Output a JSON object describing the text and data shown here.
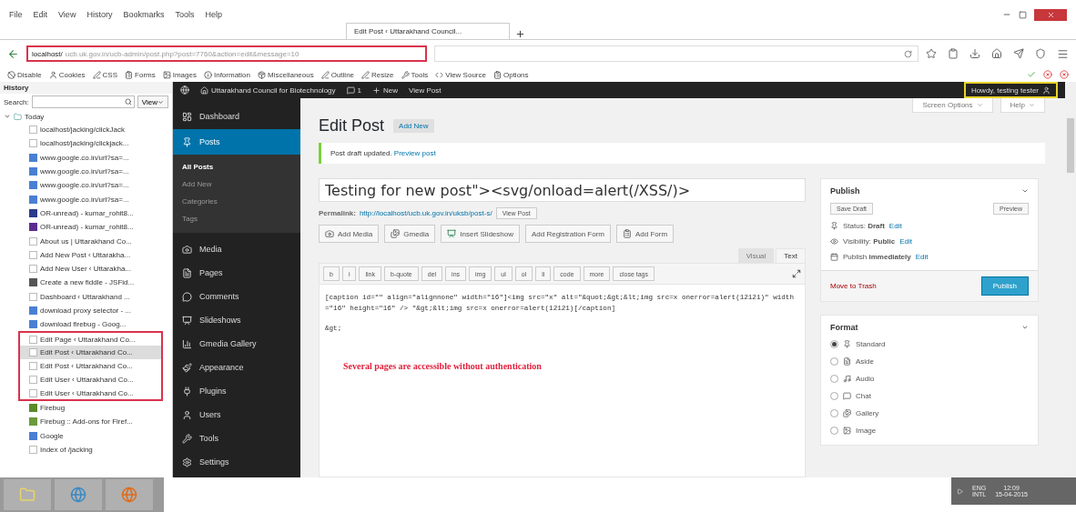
{
  "browser": {
    "menu": [
      "File",
      "Edit",
      "View",
      "History",
      "Bookmarks",
      "Tools",
      "Help"
    ],
    "tab": {
      "title": "Edit Post ‹ Uttarakhand Council..."
    },
    "url": {
      "host": "localhost/",
      "path": "ucb.uk.gov.in/ucb-admin/post.php?post=7760&action=edit&message=10",
      "annotated": true
    },
    "bookmarks_toolbar": [
      "Disable",
      "Cookies",
      "CSS",
      "Forms",
      "Images",
      "Information",
      "Miscellaneous",
      "Outline",
      "Resize",
      "Tools",
      "View Source",
      "Options"
    ]
  },
  "history": {
    "title": "History",
    "search_label": "Search:",
    "view_button": "View",
    "group": {
      "label": "Today",
      "expanded": true,
      "children": [
        {
          "label": "localhost/jacking/clickJack",
          "kind": "page",
          "selected": false,
          "annotated": false
        },
        {
          "label": "localhost/jacking/clickjack...",
          "kind": "page",
          "selected": false,
          "annotated": false
        },
        {
          "label": "www.google.co.in/url?sa=...",
          "kind": "google",
          "selected": false,
          "annotated": false
        },
        {
          "label": "www.google.co.in/url?sa=...",
          "kind": "google",
          "selected": false,
          "annotated": false
        },
        {
          "label": "www.google.co.in/url?sa=...",
          "kind": "google",
          "selected": false,
          "annotated": false
        },
        {
          "label": "www.google.co.in/url?sa=...",
          "kind": "google",
          "selected": false,
          "annotated": false
        },
        {
          "label": "OR-unread) - kumar_rohit8...",
          "kind": "mail",
          "selected": false,
          "annotated": false
        },
        {
          "label": "OR-unread) - kumar_rohit8...",
          "kind": "yahoo",
          "selected": false,
          "annotated": false
        },
        {
          "label": "About us | Uttarakhand Co...",
          "kind": "page",
          "selected": false,
          "annotated": false
        },
        {
          "label": "Add New Post ‹ Uttarakha...",
          "kind": "page",
          "selected": false,
          "annotated": false
        },
        {
          "label": "Add New User ‹ Uttarakha...",
          "kind": "page",
          "selected": false,
          "annotated": false
        },
        {
          "label": "Create a new fiddle - JSFid...",
          "kind": "cloud",
          "selected": false,
          "annotated": false
        },
        {
          "label": "Dashboard ‹ Uttarakhand ...",
          "kind": "page",
          "selected": false,
          "annotated": false
        },
        {
          "label": "download proxy selector - ...",
          "kind": "google",
          "selected": false,
          "annotated": false
        },
        {
          "label": "download firebug - Goog...",
          "kind": "google",
          "selected": false,
          "annotated": false
        },
        {
          "label": "Edit Page ‹ Uttarakhand Co...",
          "kind": "page",
          "selected": false,
          "annotated": true
        },
        {
          "label": "Edit Post ‹ Uttarakhand Co...",
          "kind": "page",
          "selected": true,
          "annotated": true
        },
        {
          "label": "Edit Post ‹ Uttarakhand Co...",
          "kind": "page",
          "selected": false,
          "annotated": true
        },
        {
          "label": "Edit User ‹ Uttarakhand Co...",
          "kind": "page",
          "selected": false,
          "annotated": true
        },
        {
          "label": "Edit User ‹ Uttarakhand Co...",
          "kind": "page",
          "selected": false,
          "annotated": true
        },
        {
          "label": "Firebug",
          "kind": "bug",
          "selected": false,
          "annotated": false
        },
        {
          "label": "Firebug :: Add-ons for Firef...",
          "kind": "puzzle",
          "selected": false,
          "annotated": false
        },
        {
          "label": "Google",
          "kind": "google",
          "selected": false,
          "annotated": false
        },
        {
          "label": "Index of /jacking",
          "kind": "page",
          "selected": false,
          "annotated": false
        }
      ]
    }
  },
  "wp": {
    "admin_bar": {
      "site": "Uttarakhand Council for Biotechnology",
      "comments": "1",
      "new": "New",
      "view": "View Post",
      "account": "Howdy, testing tester",
      "highlighted": true
    },
    "menu": [
      {
        "label": "Dashboard",
        "selected": false
      },
      {
        "label": "Posts",
        "selected": true,
        "children": [
          {
            "label": "All Posts",
            "selected": true
          },
          {
            "label": "Add New",
            "selected": false
          },
          {
            "label": "Categories",
            "selected": false
          },
          {
            "label": "Tags",
            "selected": false
          }
        ]
      },
      {
        "label": "Media",
        "selected": false
      },
      {
        "label": "Pages",
        "selected": false
      },
      {
        "label": "Comments",
        "selected": false
      },
      {
        "label": "Slideshows",
        "selected": false
      },
      {
        "label": "Gmedia Gallery",
        "selected": false
      },
      {
        "label": "Appearance",
        "selected": false
      },
      {
        "label": "Plugins",
        "selected": false
      },
      {
        "label": "Users",
        "selected": false
      },
      {
        "label": "Tools",
        "selected": false
      },
      {
        "label": "Settings",
        "selected": false
      }
    ],
    "screen_options": "Screen Options",
    "help": "Help",
    "heading": "Edit Post",
    "add_new": "Add New",
    "notice": {
      "text": "Post draft updated.",
      "link": "Preview post"
    },
    "title_value": "Testing for new post\"><svg/onload=alert(/XSS/)>",
    "permalink": {
      "label": "Permalink:",
      "url": "http://localhost/ucb.uk.gov.in/uksb/post-s/",
      "button": "View Post"
    },
    "media_buttons": [
      "Add Media",
      "Gmedia",
      "Insert Slideshow",
      "Add Registration Form",
      "Add Form"
    ],
    "editor_tabs": [
      {
        "label": "Visual",
        "selected": false
      },
      {
        "label": "Text",
        "selected": true
      }
    ],
    "quicktags": [
      "b",
      "i",
      "link",
      "b-quote",
      "del",
      "ins",
      "img",
      "ul",
      "ol",
      "li",
      "code",
      "more",
      "close tags"
    ],
    "content": [
      "[caption id=\"\" align=\"alignnone\" width=\"16\"]<img src=\"x\" alt=\"&quot;&gt;&lt;img src=x onerror=alert(12121)\" width=\"16\" height=\"16\" /> \"&gt;&lt;img src=x onerror=alert(12121)[/caption]",
      "&gt;"
    ],
    "annotation": "Several pages are accessible without authentication",
    "publish": {
      "title": "Publish",
      "save_draft": "Save Draft",
      "preview": "Preview",
      "rows": [
        {
          "label": "Status:",
          "value": "Draft",
          "link": "Edit"
        },
        {
          "label": "Visibility:",
          "value": "Public",
          "link": "Edit"
        },
        {
          "label": "Publish",
          "value": "immediately",
          "link": "Edit"
        }
      ],
      "trash": "Move to Trash",
      "button": "Publish"
    },
    "format": {
      "title": "Format",
      "options": [
        {
          "label": "Standard",
          "selected": true
        },
        {
          "label": "Aside",
          "selected": false
        },
        {
          "label": "Audio",
          "selected": false
        },
        {
          "label": "Chat",
          "selected": false
        },
        {
          "label": "Gallery",
          "selected": false
        },
        {
          "label": "Image",
          "selected": false
        }
      ]
    }
  },
  "tray": {
    "lang": [
      "ENG",
      "INTL"
    ],
    "clock": [
      "12:09",
      "15-04-2015"
    ]
  }
}
